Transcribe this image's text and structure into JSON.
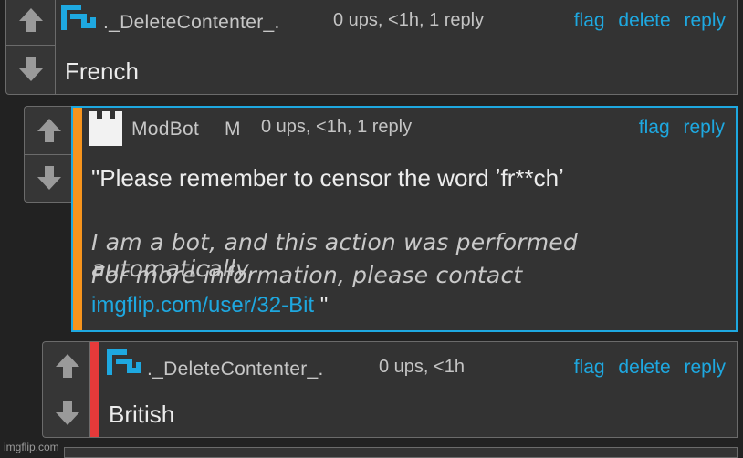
{
  "comments": [
    {
      "username": "._DeleteContenter_.",
      "meta": "0 ups, <1h, 1 reply",
      "actions": [
        "flag",
        "delete",
        "reply"
      ],
      "text": "French"
    },
    {
      "username": "ModBot",
      "badge": "M",
      "meta": "0 ups, <1h, 1 reply",
      "actions": [
        "flag",
        "reply"
      ],
      "text": "\"Please remember to censor the word ʼfr**chʼ",
      "italic_line1": "I am a bot, and this action was performed automatically.",
      "italic_line2": "For more information, please contact",
      "link": "imgflip.com/user/32-Bit",
      "link_suffix": " \"",
      "stripe_color": "#f7941d"
    },
    {
      "username": "._DeleteContenter_.",
      "meta": "0 ups, <1h",
      "actions": [
        "flag",
        "delete",
        "reply"
      ],
      "text": "British",
      "stripe_color": "#e63a3a"
    }
  ],
  "watermark": "imgflip.com",
  "colors": {
    "link": "#1ea8e0",
    "background": "#222222",
    "card": "#333333"
  }
}
